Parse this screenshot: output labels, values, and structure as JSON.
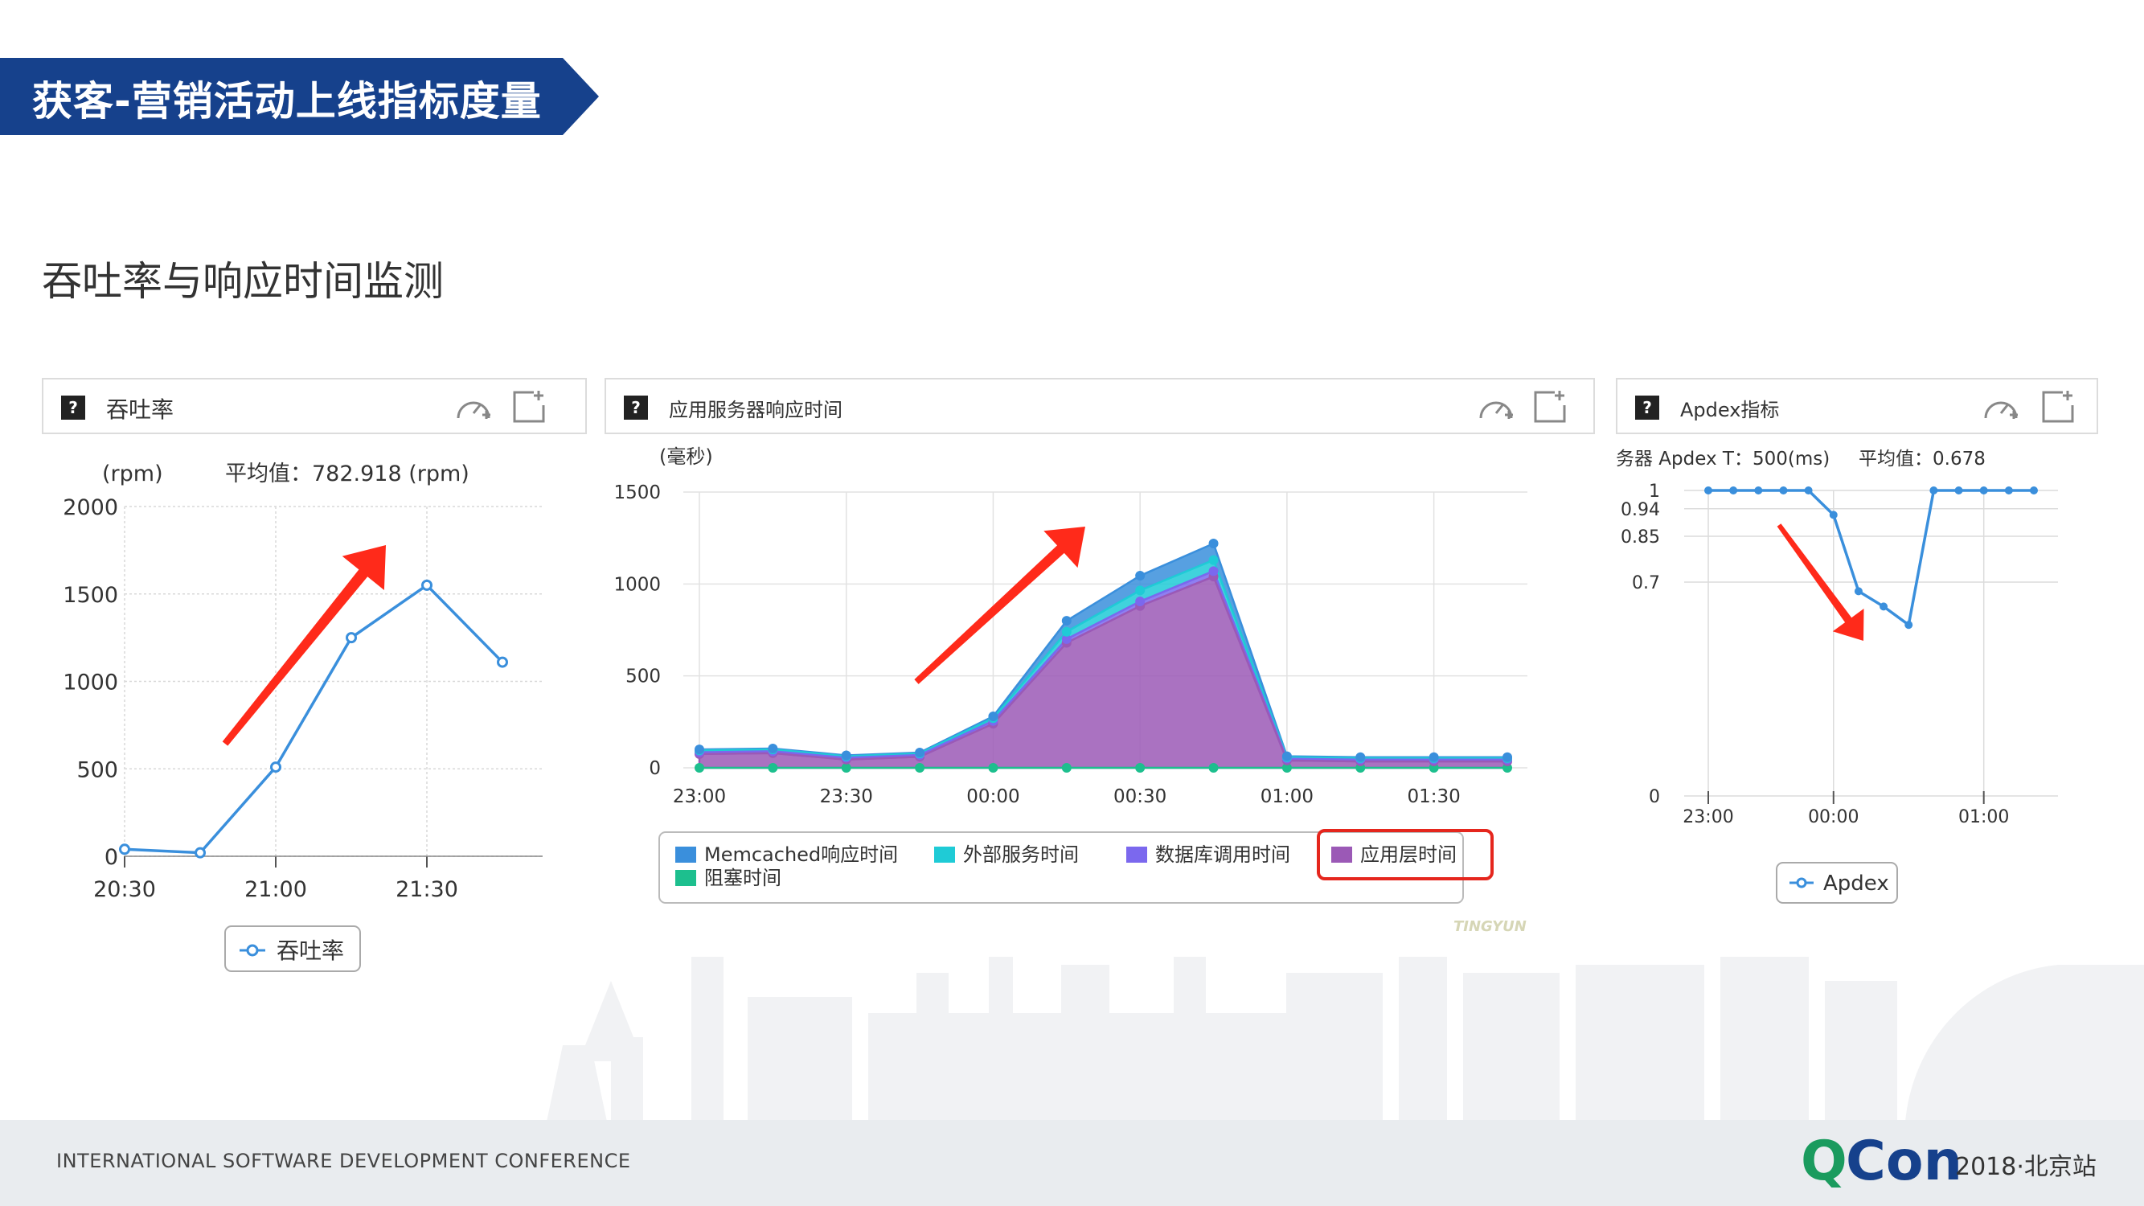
{
  "slide": {
    "title": "获客-营销活动上线指标度量",
    "subtitle": "吞吐率与响应时间监测",
    "footer": "INTERNATIONAL SOFTWARE DEVELOPMENT CONFERENCE",
    "logo_q": "Q",
    "logo_con": "Con",
    "logo_edition": "2018·北京站",
    "banner_color": "#16418c"
  },
  "panels": {
    "throughput": {
      "title": "吞吐率",
      "unit": "(rpm)",
      "avg": "平均值：782.918 (rpm)"
    },
    "response": {
      "title": "应用服务器响应时间",
      "unit": "(毫秒)",
      "watermark": "TINGYUN"
    },
    "apdex": {
      "title": "Apdex指标",
      "header_left": "务器 Apdex T：500(ms)",
      "avg": "平均值：0.678"
    }
  },
  "chart_data": [
    {
      "type": "line",
      "x": [
        "20:30",
        "20:45",
        "21:00",
        "21:15",
        "21:30",
        "21:45"
      ],
      "xticks": [
        "20:30",
        "21:00",
        "21:30"
      ],
      "series": [
        {
          "name": "吞吐率",
          "values": [
            40,
            20,
            510,
            1250,
            1550,
            1110
          ],
          "color": "#3a8fdc"
        }
      ],
      "ylabel": "(rpm)",
      "ylim": [
        0,
        2000
      ],
      "yticks": [
        0,
        500,
        1000,
        1500,
        2000
      ],
      "legend": "bottom"
    },
    {
      "type": "area",
      "stacked": true,
      "x": [
        "23:00",
        "23:15",
        "23:30",
        "23:45",
        "00:00",
        "00:15",
        "00:30",
        "00:45",
        "01:00",
        "01:15",
        "01:30",
        "01:45"
      ],
      "xticks": [
        "23:00",
        "23:30",
        "00:00",
        "00:30",
        "01:00",
        "01:30"
      ],
      "series": [
        {
          "name": "阻塞时间",
          "color": "#1dbf8e",
          "values": [
            0,
            0,
            0,
            0,
            0,
            0,
            0,
            0,
            0,
            0,
            0,
            0
          ]
        },
        {
          "name": "应用层时间",
          "color": "#9b59b6",
          "values": [
            75,
            80,
            45,
            60,
            240,
            680,
            880,
            1040,
            40,
            35,
            35,
            35
          ]
        },
        {
          "name": "数据库调用时间",
          "color": "#7b68ee",
          "values": [
            10,
            10,
            10,
            10,
            15,
            20,
            25,
            30,
            10,
            10,
            10,
            10
          ]
        },
        {
          "name": "外部服务时间",
          "color": "#1fcbd6",
          "values": [
            10,
            10,
            8,
            8,
            15,
            40,
            60,
            60,
            8,
            8,
            8,
            8
          ]
        },
        {
          "name": "Memcached响应时间",
          "color": "#3a8fdc",
          "values": [
            5,
            5,
            5,
            5,
            10,
            60,
            80,
            90,
            5,
            5,
            5,
            5
          ]
        }
      ],
      "legend_order": [
        "Memcached响应时间",
        "外部服务时间",
        "数据库调用时间",
        "应用层时间",
        "阻塞时间"
      ],
      "highlighted_legend": "应用层时间",
      "ylabel": "(毫秒)",
      "ylim": [
        0,
        1500
      ],
      "yticks": [
        0,
        500,
        1000,
        1500
      ],
      "legend": "bottom"
    },
    {
      "type": "line",
      "x": [
        "23:00",
        "23:10",
        "23:20",
        "23:30",
        "23:40",
        "00:00",
        "00:10",
        "00:20",
        "00:30",
        "00:40",
        "00:50",
        "01:00",
        "01:10",
        "01:20"
      ],
      "xticks": [
        "23:00",
        "00:00",
        "01:00"
      ],
      "series": [
        {
          "name": "Apdex",
          "color": "#3a8fdc",
          "values": [
            1,
            1,
            1,
            1,
            1,
            0.92,
            0.67,
            0.62,
            0.56,
            1,
            1,
            1,
            1,
            1
          ]
        }
      ],
      "ylim": [
        0,
        1
      ],
      "yticks": [
        "0",
        "0.7",
        "0.85",
        "0.94",
        "1"
      ],
      "legend": "bottom"
    }
  ]
}
